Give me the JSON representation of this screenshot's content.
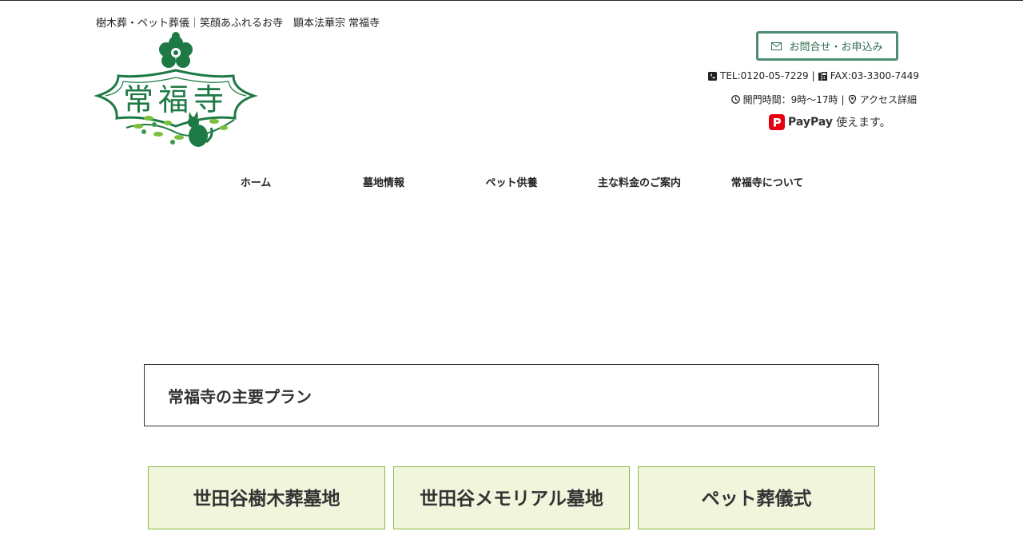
{
  "header": {
    "tagline": "樹木葬・ペット葬儀｜笑顔あふれるお寺　顕本法華宗 常福寺",
    "logo_text": "常福寺"
  },
  "contact": {
    "button_label": "お問合せ・お申込み",
    "tel": "TEL:0120-05-7229",
    "sep": "|",
    "fax": "FAX:03-3300-7449",
    "hours": "開門時間：9時～17時",
    "access": "アクセス詳細",
    "paypay_name": "PayPay",
    "paypay_text": "使えます。"
  },
  "nav": {
    "items": [
      {
        "label": "ホーム"
      },
      {
        "label": "墓地情報"
      },
      {
        "label": "ペット供養"
      },
      {
        "label": "主な料金のご案内"
      },
      {
        "label": "常福寺について"
      }
    ]
  },
  "plans": {
    "heading": "常福寺の主要プラン",
    "cards": [
      {
        "label": "世田谷樹木葬墓地"
      },
      {
        "label": "世田谷メモリアル墓地"
      },
      {
        "label": "ペット葬儀式"
      }
    ]
  },
  "colors": {
    "brand_green": "#1e7a45",
    "button_border": "#4e8f72",
    "card_bg": "#f1f5dc",
    "card_border": "#8cbc3f",
    "paypay_red": "#e60012"
  }
}
